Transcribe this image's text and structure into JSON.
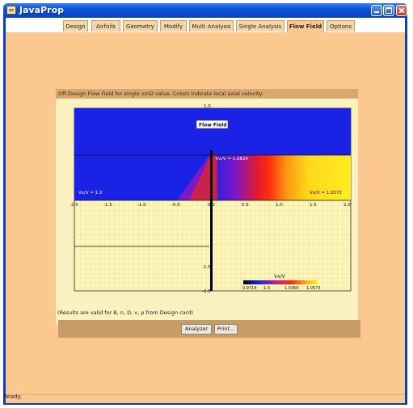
{
  "window": {
    "title": "JavaProp"
  },
  "tabs": [
    {
      "label": "Design"
    },
    {
      "label": "Airfoils"
    },
    {
      "label": "Geometry"
    },
    {
      "label": "Modify"
    },
    {
      "label": "Multi Analysis"
    },
    {
      "label": "Single Analysis"
    },
    {
      "label": "Flow Field",
      "active": true
    },
    {
      "label": "Options"
    }
  ],
  "panel": {
    "title": "Off-Design Flow Field for single v/nD value. Colors indicate local axial velocity.",
    "note": "(Results are valid for B, n, D, v, ρ from Design card)"
  },
  "plot": {
    "title": "Flow Field",
    "x_ticks": [
      "-2.0",
      "-1.5",
      "-1.0",
      "-0.5",
      "0.0",
      "0.5",
      "1.0",
      "1.5",
      "2.0"
    ],
    "y_ticks": [
      "1.0",
      "-1.5",
      "-2.0"
    ],
    "labels": {
      "left": "Vx/V = 1.0",
      "center": "Vx/V = 1.0824",
      "right": "Vx/V = 1.0572"
    },
    "legend": {
      "title": "Vx/V",
      "ticks": [
        "0.9714",
        "1.0",
        "1.0366",
        "1.0573"
      ]
    },
    "colors": {
      "free_stream": "#1a22e6",
      "max_velocity": "#ffee22",
      "grid_bg": "#fdf6b8"
    }
  },
  "buttons": {
    "analyze": "Analyze!",
    "print": "Print..."
  },
  "status": "Ready."
}
